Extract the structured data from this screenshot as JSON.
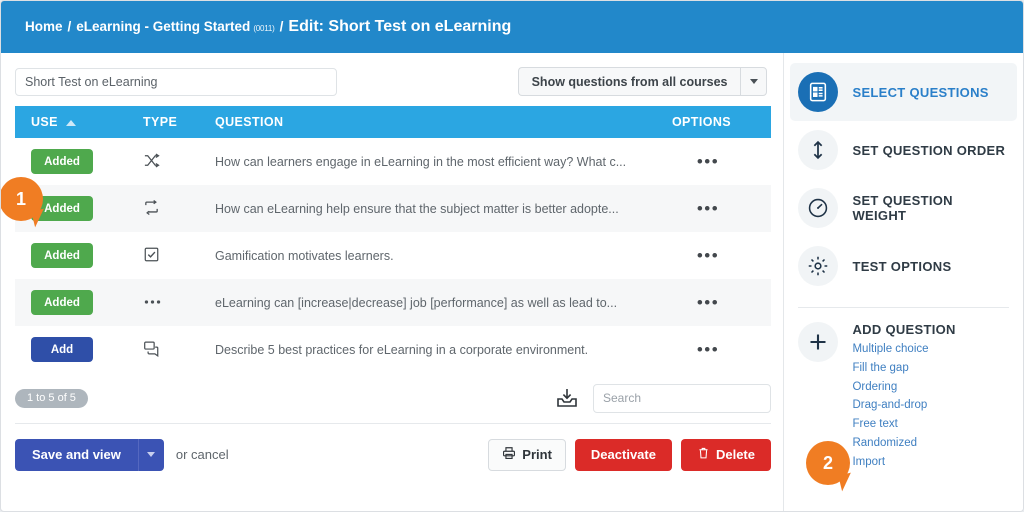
{
  "breadcrumb": {
    "home": "Home",
    "sep": "/",
    "course": "eLearning - Getting Started",
    "course_id": "(0011)",
    "current": "Edit: Short Test on eLearning"
  },
  "filters": {
    "title_value": "Short Test on eLearning",
    "title_placeholder": "Test title",
    "scope_button": "Show questions from all courses"
  },
  "table": {
    "columns": {
      "use": "USE",
      "type": "TYPE",
      "question": "QUESTION",
      "options": "OPTIONS"
    },
    "rows": [
      {
        "use_label": "Added",
        "use_state": "added",
        "type_icon": "shuffle-icon",
        "question": "How can learners engage in eLearning in the most efficient way? What c...",
        "options_label": "•••"
      },
      {
        "use_label": "Added",
        "use_state": "added",
        "type_icon": "ordering-icon",
        "question": "How can eLearning help ensure that the subject matter is better adopte...",
        "options_label": "•••"
      },
      {
        "use_label": "Added",
        "use_state": "added",
        "type_icon": "checkbox-icon",
        "question": "Gamification motivates learners.",
        "options_label": "•••"
      },
      {
        "use_label": "Added",
        "use_state": "added",
        "type_icon": "fill-gap-icon",
        "question": "eLearning can [increase|decrease] job [performance] as well as lead to...",
        "options_label": "•••"
      },
      {
        "use_label": "Add",
        "use_state": "add",
        "type_icon": "free-text-icon",
        "question": "Describe 5 best practices for eLearning in a corporate environment.",
        "options_label": "•••"
      }
    ],
    "footer": {
      "count": "1 to 5 of 5",
      "search_placeholder": "Search",
      "search_value": ""
    }
  },
  "actions": {
    "save": "Save and view",
    "or_cancel": "or cancel",
    "print": "Print",
    "deactivate": "Deactivate",
    "delete": "Delete"
  },
  "sidebar": {
    "nav": [
      {
        "label": "SELECT QUESTIONS",
        "icon": "list-document-icon",
        "active": true
      },
      {
        "label": "SET QUESTION ORDER",
        "icon": "updown-arrow-icon",
        "active": false
      },
      {
        "label": "SET QUESTION WEIGHT",
        "icon": "gauge-icon",
        "active": false
      },
      {
        "label": "TEST OPTIONS",
        "icon": "gear-icon",
        "active": false
      }
    ],
    "add_question": {
      "title": "ADD QUESTION",
      "icon": "plus-icon",
      "links": [
        "Multiple choice",
        "Fill the gap",
        "Ordering",
        "Drag-and-drop",
        "Free text",
        "Randomized",
        "Import"
      ]
    }
  },
  "callouts": [
    {
      "number": "1"
    },
    {
      "number": "2"
    }
  ],
  "colors": {
    "brand_blue": "#2288ca",
    "table_header": "#2ba6e2",
    "added_green": "#4fa94d",
    "add_blue": "#2f4fa8",
    "save_blue": "#3b53b4",
    "danger_red": "#db2b28",
    "callout_orange": "#f07d23",
    "link_blue": "#3f7fc1"
  }
}
